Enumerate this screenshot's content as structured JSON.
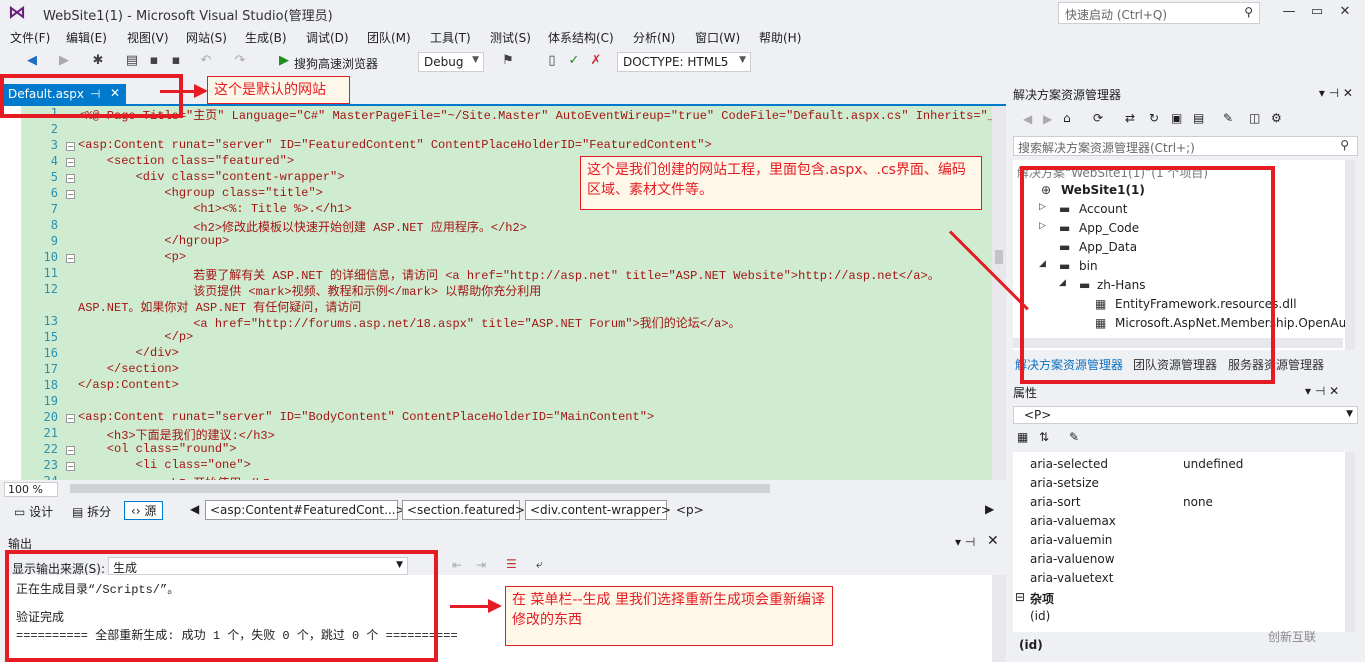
{
  "window": {
    "title": "WebSite1(1) - Microsoft Visual Studio(管理员)",
    "quick_launch_placeholder": "快速启动 (Ctrl+Q)"
  },
  "menu": [
    "文件(F)",
    "编辑(E)",
    "视图(V)",
    "网站(S)",
    "生成(B)",
    "调试(D)",
    "团队(M)",
    "工具(T)",
    "测试(S)",
    "体系结构(C)",
    "分析(N)",
    "窗口(W)",
    "帮助(H)"
  ],
  "toolbar": {
    "browser_label": "搜狗高速浏览器",
    "config": "Debug",
    "doctype": "DOCTYPE:  HTML5"
  },
  "doc_tab": {
    "label": "Default.aspx"
  },
  "editor": {
    "lines": [
      {
        "n": "1",
        "text": "<%@ Page Title=\"主页\" Language=\"C#\" MasterPageFile=\"~/Site.Master\" AutoEventWireup=\"true\" CodeFile=\"Default.aspx.cs\" Inherits=\"_De"
      },
      {
        "n": "2",
        "text": ""
      },
      {
        "n": "3",
        "text": "<asp:Content runat=\"server\" ID=\"FeaturedContent\" ContentPlaceHolderID=\"FeaturedContent\">"
      },
      {
        "n": "4",
        "text": "    <section class=\"featured\">"
      },
      {
        "n": "5",
        "text": "        <div class=\"content-wrapper\">"
      },
      {
        "n": "6",
        "text": "            <hgroup class=\"title\">"
      },
      {
        "n": "7",
        "text": "                <h1><%: Title %>.</h1>"
      },
      {
        "n": "8",
        "text": "                <h2>修改此模板以快速开始创建 ASP.NET 应用程序。</h2>"
      },
      {
        "n": "9",
        "text": "            </hgroup>"
      },
      {
        "n": "10",
        "text": "            <p>"
      },
      {
        "n": "11",
        "text": "                若要了解有关 ASP.NET 的详细信息，请访问 <a href=\"http://asp.net\" title=\"ASP.NET Website\">http://asp.net</a>。"
      },
      {
        "n": "12",
        "text": "                该页提供 <mark>视频、教程和示例</mark> 以帮助你充分利用"
      },
      {
        "n": "",
        "text": "ASP.NET。如果你对 ASP.NET 有任何疑问，请访问"
      },
      {
        "n": "13",
        "text": "                <a href=\"http://forums.asp.net/18.aspx\" title=\"ASP.NET Forum\">我们的论坛</a>。"
      },
      {
        "n": "15",
        "text": "            </p>"
      },
      {
        "n": "16",
        "text": "        </div>"
      },
      {
        "n": "17",
        "text": "    </section>"
      },
      {
        "n": "18",
        "text": "</asp:Content>"
      },
      {
        "n": "19",
        "text": ""
      },
      {
        "n": "20",
        "text": "<asp:Content runat=\"server\" ID=\"BodyContent\" ContentPlaceHolderID=\"MainContent\">"
      },
      {
        "n": "21",
        "text": "    <h3>下面是我们的建议:</h3>"
      },
      {
        "n": "22",
        "text": "    <ol class=\"round\">"
      },
      {
        "n": "23",
        "text": "        <li class=\"one\">"
      },
      {
        "n": "24",
        "text": "            <h5>开始使用</h5>"
      }
    ],
    "zoom": "100 %"
  },
  "viewbar": {
    "design": "设计",
    "split": "拆分",
    "source": "源",
    "breadcrumbs": [
      "<asp:Content#FeaturedCont...>",
      "<section.featured>",
      "<div.content-wrapper>",
      "<p>"
    ]
  },
  "output": {
    "title": "输出",
    "source_label": "显示输出来源(S):",
    "source_value": "生成",
    "lines": [
      "正在生成目录“/Scripts/”。",
      "",
      "验证完成",
      "========== 全部重新生成: 成功 1 个，失败 0 个，跳过 0 个 =========="
    ]
  },
  "solution": {
    "title": "解决方案资源管理器",
    "search_placeholder": "搜索解决方案资源管理器(Ctrl+;)",
    "root": "解决方案“WebSite1(1)”(1 个项目)",
    "items": [
      {
        "label": "WebSite1(1)",
        "bold": true
      },
      {
        "label": "Account"
      },
      {
        "label": "App_Code"
      },
      {
        "label": "App_Data"
      },
      {
        "label": "bin"
      },
      {
        "label": "zh-Hans"
      },
      {
        "label": "EntityFramework.resources.dll"
      },
      {
        "label": "Microsoft.AspNet.Membership.OpenAu"
      }
    ],
    "tabs": [
      "解决方案资源管理器",
      "团队资源管理器",
      "服务器资源管理器"
    ]
  },
  "properties": {
    "title": "属性",
    "selected": "<P>",
    "rows": [
      {
        "name": "aria-selected",
        "value": "undefined"
      },
      {
        "name": "aria-setsize",
        "value": ""
      },
      {
        "name": "aria-sort",
        "value": "none"
      },
      {
        "name": "aria-valuemax",
        "value": ""
      },
      {
        "name": "aria-valuemin",
        "value": ""
      },
      {
        "name": "aria-valuenow",
        "value": ""
      },
      {
        "name": "aria-valuetext",
        "value": ""
      }
    ],
    "category": "杂项",
    "id_row": "(id)",
    "desc": "(id)"
  },
  "annotations": {
    "default_site": "这个是默认的网站",
    "project_note": "这个是我们创建的网站工程，里面包含.aspx、.cs界面、编码区域、素材文件等。",
    "build_note": "在 菜单栏--生成 里我们选择重新生成项会重新编译修改的东西"
  },
  "watermark": "创新互联"
}
